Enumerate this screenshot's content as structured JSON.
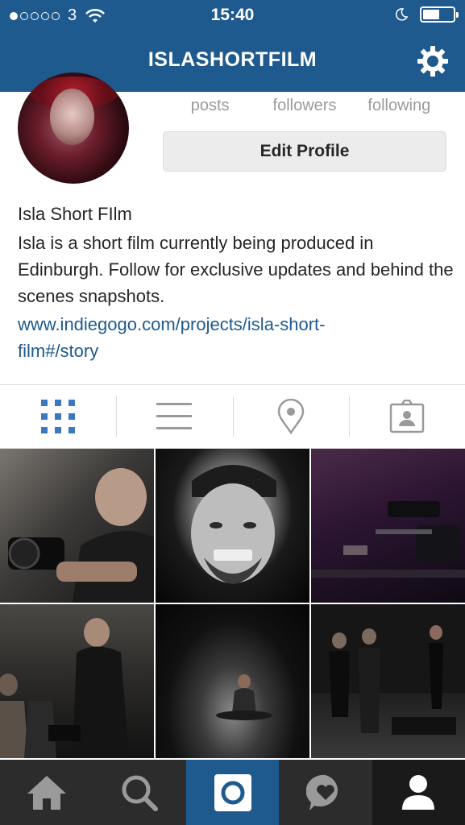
{
  "status_bar": {
    "signal_dots_filled": 1,
    "signal_dots_total": 5,
    "carrier": "3",
    "time": "15:40",
    "battery_level": 0.55
  },
  "nav": {
    "title": "ISLASHORTFILM"
  },
  "profile": {
    "stats": [
      {
        "label": "posts"
      },
      {
        "label": "followers"
      },
      {
        "label": "following"
      }
    ],
    "edit_button": "Edit Profile",
    "name": "Isla Short FIlm",
    "bio": "Isla is a short film currently being produced in Edinburgh. Follow for exclusive updates and behind the scenes snapshots.",
    "link_line1": "www.indiegogo.com/projects/isla-short-",
    "link_line2": "film#/story"
  },
  "tabs": [
    {
      "icon": "grid-view-icon",
      "active": true
    },
    {
      "icon": "list-view-icon",
      "active": false
    },
    {
      "icon": "location-pin-icon",
      "active": false
    },
    {
      "icon": "tagged-photos-icon",
      "active": false
    }
  ],
  "photos": [
    {
      "name": "photo-cameraman-with-rig"
    },
    {
      "name": "photo-grinning-man-portrait"
    },
    {
      "name": "photo-camera-on-slider"
    },
    {
      "name": "photo-crew-on-set"
    },
    {
      "name": "photo-actress-on-floor"
    },
    {
      "name": "photo-actors-rehearsing"
    }
  ],
  "bottom_nav": [
    {
      "icon": "home-icon"
    },
    {
      "icon": "search-icon"
    },
    {
      "icon": "camera-icon"
    },
    {
      "icon": "activity-heart-icon"
    },
    {
      "icon": "profile-icon"
    }
  ],
  "colors": {
    "brand_blue": "#1e5a8e",
    "link_blue": "#1e5a8e",
    "tab_active": "#3a78c0",
    "tab_inactive": "#9a9a9a",
    "bottom_bar": "#2c2c2c"
  }
}
